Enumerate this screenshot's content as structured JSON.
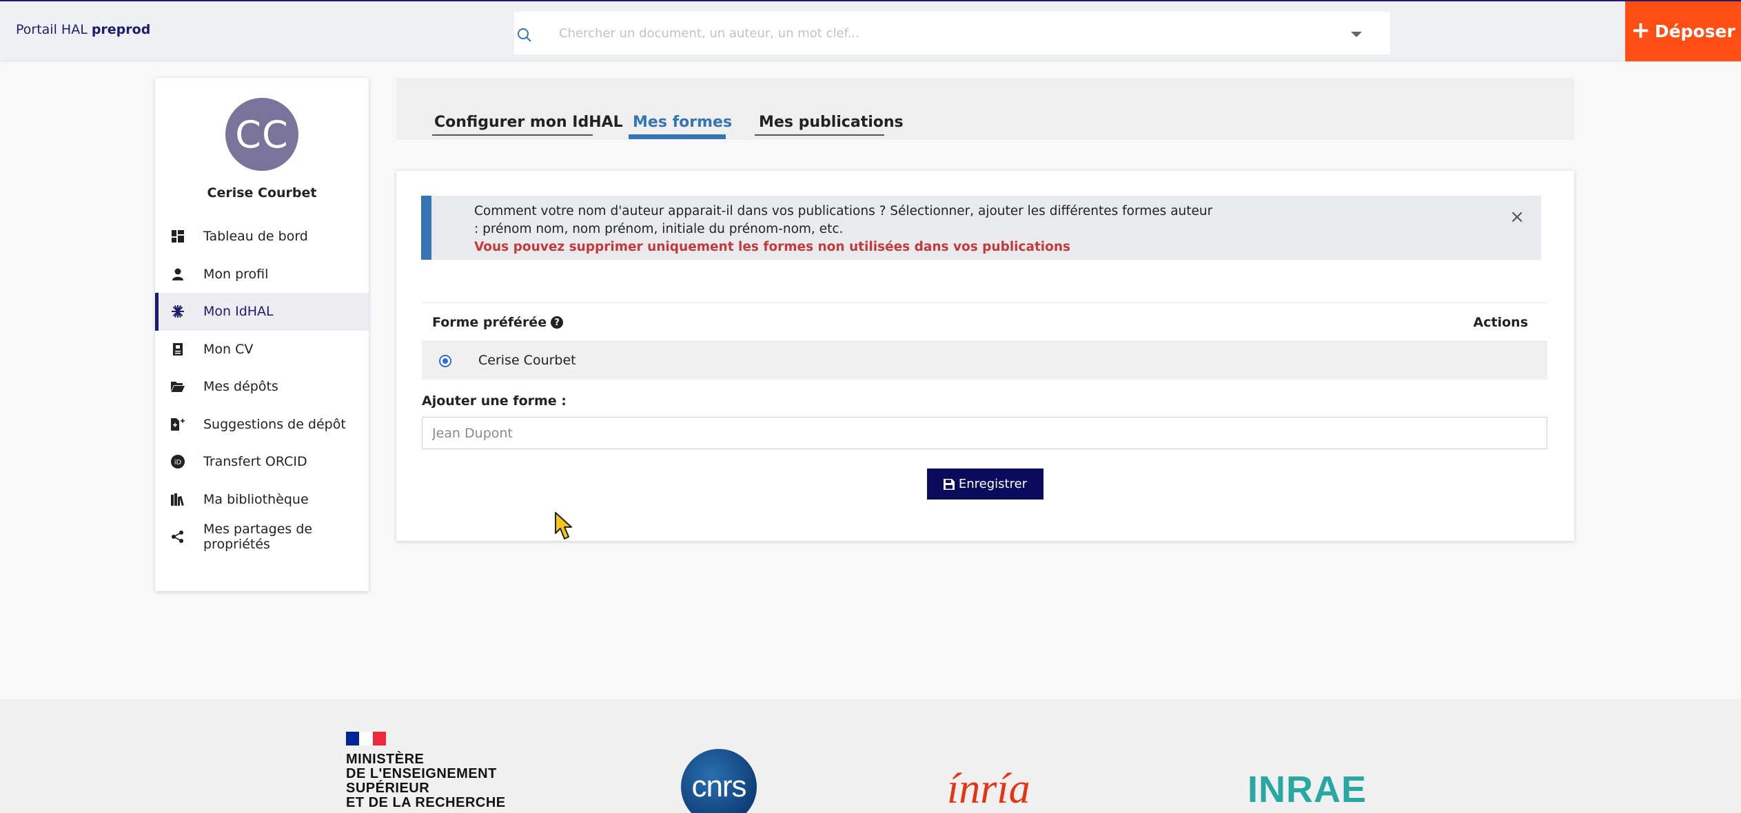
{
  "header": {
    "brand_prefix": "Portail HAL",
    "brand_suffix": "preprod",
    "search_placeholder": "Chercher un document, un auteur, un mot clef...",
    "deposit_label": "Déposer"
  },
  "sidebar": {
    "avatar_initials": "CC",
    "user_name": "Cerise Courbet",
    "items": [
      {
        "label": "Tableau de bord",
        "icon": "dashboard-icon"
      },
      {
        "label": "Mon profil",
        "icon": "user-icon"
      },
      {
        "label": "Mon IdHAL",
        "icon": "idhal-icon",
        "active": true
      },
      {
        "label": "Mon CV",
        "icon": "cv-icon"
      },
      {
        "label": "Mes dépôts",
        "icon": "folder-open-icon"
      },
      {
        "label": "Suggestions de dépôt",
        "icon": "file-plus-icon"
      },
      {
        "label": "Transfert ORCID",
        "icon": "orcid-icon"
      },
      {
        "label": "Ma bibliothèque",
        "icon": "library-icon"
      },
      {
        "label": "Mes partages de propriétés",
        "icon": "share-icon"
      }
    ]
  },
  "tabs": [
    {
      "label": "Configurer mon IdHAL"
    },
    {
      "label": "Mes formes",
      "active": true
    },
    {
      "label": "Mes publications"
    }
  ],
  "notice": {
    "text": "Comment votre nom d'auteur apparait-il dans vos publications ? Sélectionner, ajouter les différentes formes auteur : prénom nom, nom prénom, initiale du prénom-nom, etc.",
    "warning": "Vous pouvez supprimer uniquement les formes non utilisées dans vos publications",
    "close": "×"
  },
  "forms_table": {
    "col_preferred": "Forme préférée",
    "col_actions": "Actions",
    "help": "?",
    "rows": [
      {
        "name": "Cerise Courbet",
        "selected": true
      }
    ]
  },
  "add_form": {
    "label": "Ajouter une forme :",
    "placeholder": "Jean Dupont",
    "value": ""
  },
  "save_label": "Enregistrer",
  "footer": {
    "mesr_lines": [
      "MINISTÈRE",
      "DE L'ENSEIGNEMENT",
      "SUPÉRIEUR",
      "ET DE LA RECHERCHE"
    ],
    "cnrs": "cnrs",
    "inria": "ínría",
    "inrae": "INRAE"
  },
  "colors": {
    "brand_navy": "#1d1d6e",
    "accent_blue": "#3575b5",
    "deposit_orange": "#ff4e13",
    "warning_red": "#c43a3a"
  }
}
